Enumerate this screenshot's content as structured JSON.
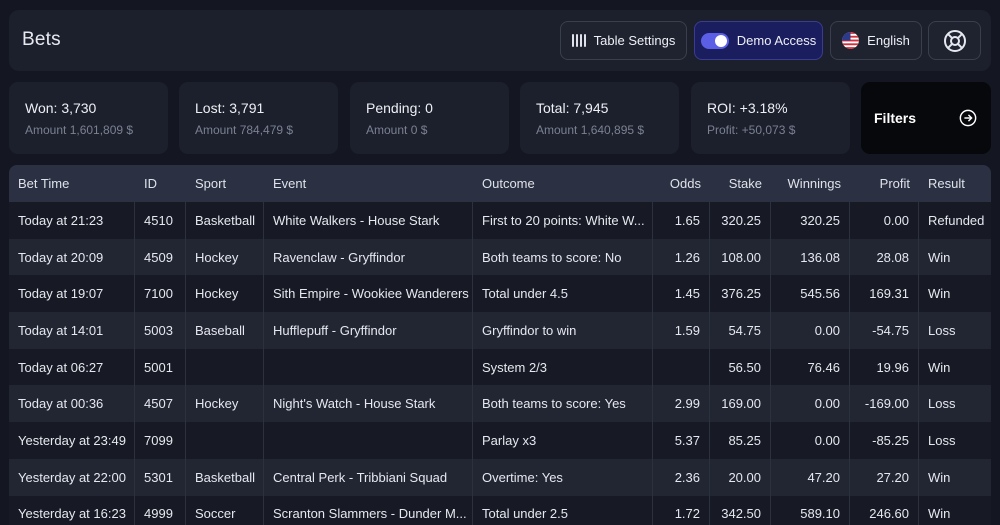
{
  "header": {
    "title": "Bets",
    "table_settings_label": "Table Settings",
    "demo_access_label": "Demo Access",
    "language_label": "English"
  },
  "stats": [
    {
      "label": "Won: 3,730",
      "sub": "Amount 1,601,809 $"
    },
    {
      "label": "Lost: 3,791",
      "sub": "Amount 784,479 $"
    },
    {
      "label": "Pending: 0",
      "sub": "Amount 0 $"
    },
    {
      "label": "Total: 7,945",
      "sub": "Amount 1,640,895 $"
    },
    {
      "label": "ROI: +3.18%",
      "sub": "Profit: +50,073 $"
    }
  ],
  "filters_label": "Filters",
  "table": {
    "columns": [
      "Bet Time",
      "ID",
      "Sport",
      "Event",
      "Outcome",
      "Odds",
      "Stake",
      "Winnings",
      "Profit",
      "Result"
    ],
    "rows": [
      {
        "time": "Today at 21:23",
        "id": "4510",
        "sport": "Basketball",
        "event": "White Walkers - House Stark",
        "outcome": "First to 20 points: White W...",
        "odds": "1.65",
        "stake": "320.25",
        "winnings": "320.25",
        "profit": "0.00",
        "result": "Refunded"
      },
      {
        "time": "Today at 20:09",
        "id": "4509",
        "sport": "Hockey",
        "event": "Ravenclaw - Gryffindor",
        "outcome": "Both teams to score: No",
        "odds": "1.26",
        "stake": "108.00",
        "winnings": "136.08",
        "profit": "28.08",
        "result": "Win"
      },
      {
        "time": "Today at 19:07",
        "id": "7100",
        "sport": "Hockey",
        "event": "Sith Empire - Wookiee Wanderers",
        "outcome": "Total under 4.5",
        "odds": "1.45",
        "stake": "376.25",
        "winnings": "545.56",
        "profit": "169.31",
        "result": "Win"
      },
      {
        "time": "Today at 14:01",
        "id": "5003",
        "sport": "Baseball",
        "event": "Hufflepuff - Gryffindor",
        "outcome": "Gryffindor to win",
        "odds": "1.59",
        "stake": "54.75",
        "winnings": "0.00",
        "profit": "-54.75",
        "result": "Loss"
      },
      {
        "time": "Today at 06:27",
        "id": "5001",
        "sport": "",
        "event": "",
        "outcome": "System 2/3",
        "odds": "",
        "stake": "56.50",
        "winnings": "76.46",
        "profit": "19.96",
        "result": "Win"
      },
      {
        "time": "Today at 00:36",
        "id": "4507",
        "sport": "Hockey",
        "event": "Night's Watch - House Stark",
        "outcome": "Both teams to score: Yes",
        "odds": "2.99",
        "stake": "169.00",
        "winnings": "0.00",
        "profit": "-169.00",
        "result": "Loss"
      },
      {
        "time": "Yesterday at 23:49",
        "id": "7099",
        "sport": "",
        "event": "",
        "outcome": "Parlay x3",
        "odds": "5.37",
        "stake": "85.25",
        "winnings": "0.00",
        "profit": "-85.25",
        "result": "Loss"
      },
      {
        "time": "Yesterday at 22:00",
        "id": "5301",
        "sport": "Basketball",
        "event": "Central Perk - Tribbiani Squad",
        "outcome": "Overtime: Yes",
        "odds": "2.36",
        "stake": "20.00",
        "winnings": "47.20",
        "profit": "27.20",
        "result": "Win"
      },
      {
        "time": "Yesterday at 16:23",
        "id": "4999",
        "sport": "Soccer",
        "event": "Scranton Slammers - Dunder M...",
        "outcome": "Total under 2.5",
        "odds": "1.72",
        "stake": "342.50",
        "winnings": "589.10",
        "profit": "246.60",
        "result": "Win"
      }
    ]
  },
  "colors": {
    "background": "#141722",
    "panel": "#1c202c",
    "accent": "#5b5fe6",
    "demo_button": "#1a1d5e",
    "table_header": "#2b3142"
  },
  "icons": [
    "columns-icon",
    "toggle-switch",
    "us-flag-icon",
    "lifebuoy-icon",
    "arrow-right-circle-icon"
  ]
}
